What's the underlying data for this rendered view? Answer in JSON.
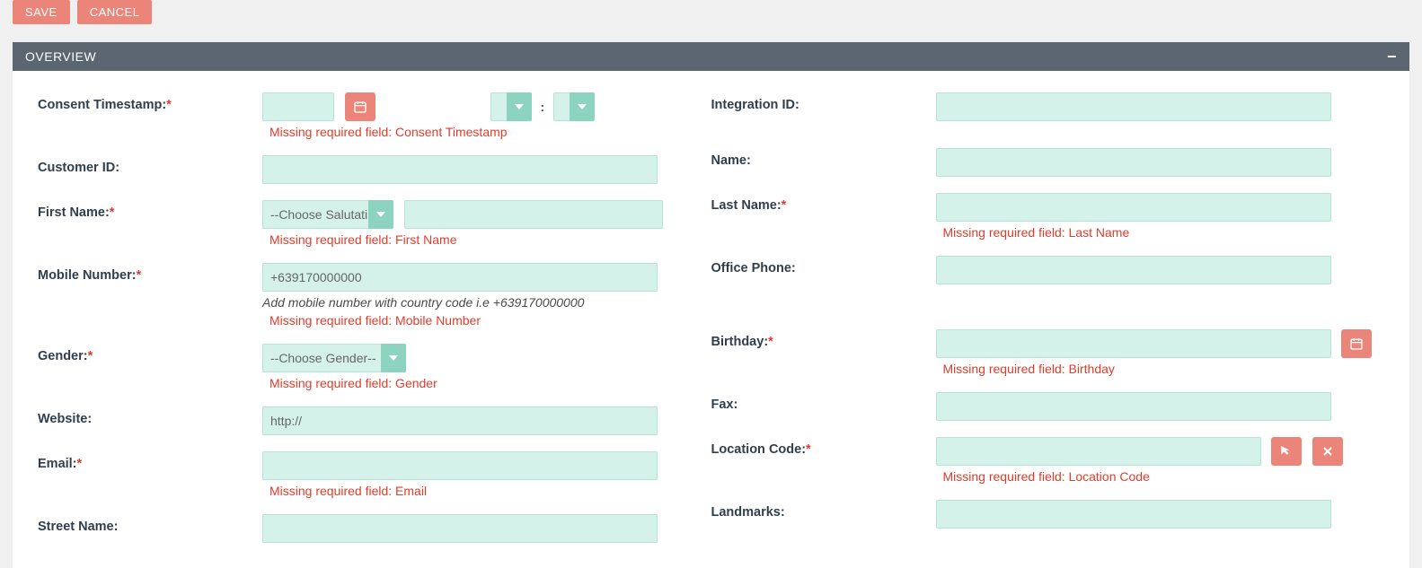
{
  "buttons": {
    "save": "SAVE",
    "cancel": "CANCEL"
  },
  "panel_title": "OVERVIEW",
  "fields": {
    "consent_timestamp": {
      "label": "Consent Timestamp:",
      "error": "Missing required field: Consent Timestamp"
    },
    "integration_id": {
      "label": "Integration ID:"
    },
    "customer_id": {
      "label": "Customer ID:"
    },
    "name": {
      "label": "Name:"
    },
    "first_name": {
      "label": "First Name:",
      "salutation_placeholder": "--Choose Salutation--",
      "error": "Missing required field: First Name"
    },
    "last_name": {
      "label": "Last Name:",
      "error": "Missing required field: Last Name"
    },
    "mobile": {
      "label": "Mobile Number:",
      "placeholder": "+639170000000",
      "hint": "Add mobile number with country code i.e +639170000000",
      "error": "Missing required field: Mobile Number"
    },
    "office_phone": {
      "label": "Office Phone:"
    },
    "gender": {
      "label": "Gender:",
      "placeholder": "--Choose Gender--",
      "error": "Missing required field: Gender"
    },
    "birthday": {
      "label": "Birthday:",
      "error": "Missing required field: Birthday"
    },
    "website": {
      "label": "Website:",
      "placeholder": "http://"
    },
    "fax": {
      "label": "Fax:"
    },
    "email": {
      "label": "Email:",
      "error": "Missing required field: Email"
    },
    "location_code": {
      "label": "Location Code:",
      "error": "Missing required field: Location Code"
    },
    "street_name": {
      "label": "Street Name:"
    },
    "landmarks": {
      "label": "Landmarks:"
    }
  },
  "colors": {
    "accent": "#ec8579",
    "field_bg": "#d4f2e9",
    "header_bg": "#5c6670",
    "error": "#e13c2b"
  }
}
